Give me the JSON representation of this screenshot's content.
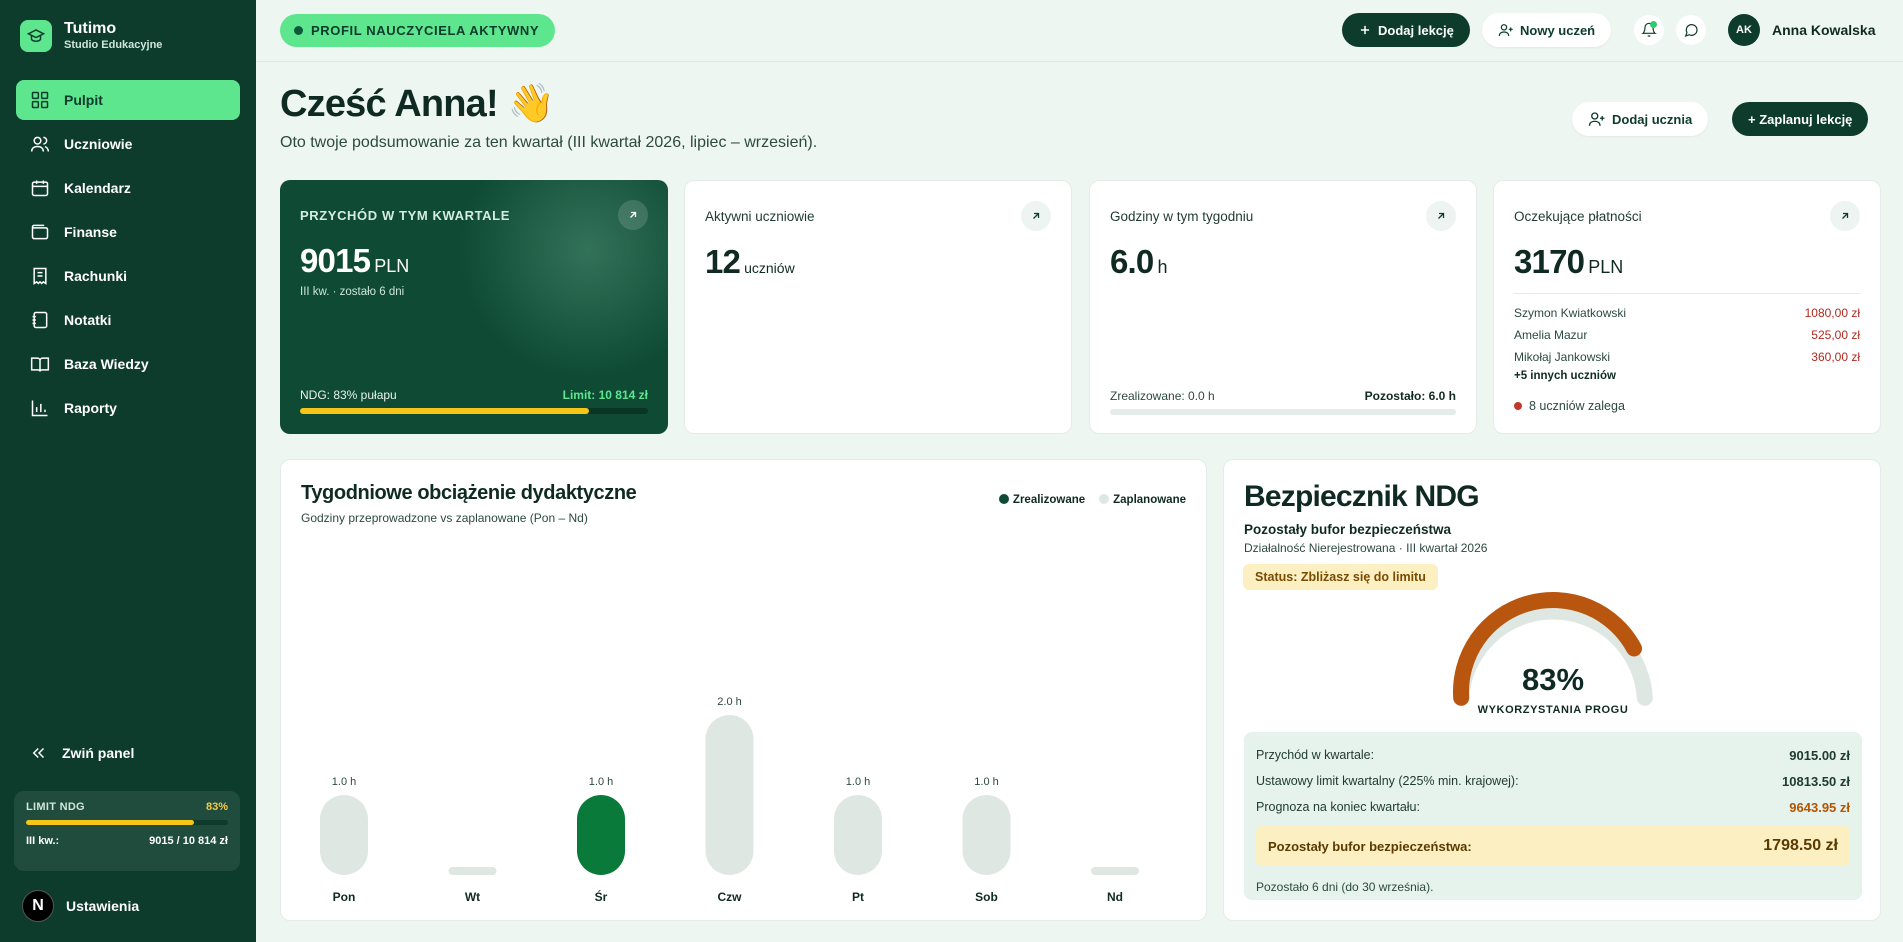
{
  "brand": {
    "name": "Tutimo",
    "subtitle": "Studio Edukacyjne"
  },
  "sidebar": {
    "items": [
      {
        "label": "Pulpit",
        "icon": "grid-icon",
        "active": true
      },
      {
        "label": "Uczniowie",
        "icon": "users-icon"
      },
      {
        "label": "Kalendarz",
        "icon": "calendar-icon"
      },
      {
        "label": "Finanse",
        "icon": "wallet-icon"
      },
      {
        "label": "Rachunki",
        "icon": "receipt-icon"
      },
      {
        "label": "Notatki",
        "icon": "notebook-icon"
      },
      {
        "label": "Baza Wiedzy",
        "icon": "book-icon"
      },
      {
        "label": "Raporty",
        "icon": "bar-chart-icon"
      }
    ],
    "collapse_label": "Zwiń panel",
    "limit": {
      "label": "LIMIT NDG",
      "percent_label": "83%",
      "fill": 0.83,
      "period_label": "III kw.:",
      "value": "9015 / 10 814 zł"
    },
    "settings_label": "Ustawienia",
    "settings_avatar": "N"
  },
  "topbar": {
    "profile_status": "PROFIL NAUCZYCIELA AKTYWNY",
    "add_lesson": "Dodaj lekcję",
    "new_student": "Nowy uczeń",
    "user": {
      "initials": "AK",
      "name": "Anna Kowalska"
    }
  },
  "greeting": {
    "title": "Cześć Anna! 👋",
    "subtitle": "Oto twoje podsumowanie za ten kwartał (III kwartał 2026, lipiec – wrzesień).",
    "add_student": "Dodaj ucznia",
    "schedule_lesson": "+ Zaplanuj lekcję"
  },
  "stats": {
    "revenue": {
      "title": "PRZYCHÓD W TYM KWARTALE",
      "value": "9015",
      "unit": "PLN",
      "note": "III kw. · zostało 6 dni",
      "ndg_label": "NDG: 83% pułapu",
      "limit_label": "Limit: 10 814 zł",
      "fill": 0.83
    },
    "students": {
      "title": "Aktywni uczniowie",
      "value": "12",
      "unit": "uczniów"
    },
    "hours": {
      "title": "Godziny w tym tygodniu",
      "value": "6.0",
      "unit": "h",
      "done_label": "Zrealizowane: 0.0 h",
      "left_label": "Pozostało: 6.0 h",
      "fill": 0.0
    },
    "payments": {
      "title": "Oczekujące płatności",
      "value": "3170",
      "unit": "PLN",
      "rows": [
        {
          "name": "Szymon Kwiatkowski",
          "amount": "1080,00 zł"
        },
        {
          "name": "Amelia Mazur",
          "amount": "525,00 zł"
        },
        {
          "name": "Mikołaj Jankowski",
          "amount": "360,00 zł"
        }
      ],
      "more": "+5 innych uczniów",
      "overdue": "8 uczniów zalega"
    }
  },
  "chart": {
    "title": "Tygodniowe obciążenie dydaktyczne",
    "subtitle": "Godziny przeprowadzone vs zaplanowane (Pon – Nd)",
    "legend_done": "Zrealizowane",
    "legend_planned": "Zaplanowane",
    "colors": {
      "done": "#0e4a34",
      "planned": "#dfe7e3",
      "highlight": "#0a7a3a"
    }
  },
  "chart_data": {
    "type": "bar",
    "categories": [
      "Pon",
      "Wt",
      "Śr",
      "Czw",
      "Pt",
      "Sob",
      "Nd"
    ],
    "values": [
      1.0,
      0,
      1.0,
      2.0,
      1.0,
      1.0,
      0
    ],
    "value_labels": [
      "1.0 h",
      "",
      "1.0 h",
      "2.0 h",
      "1.0 h",
      "1.0 h",
      ""
    ],
    "highlight_index": 2,
    "ylim": [
      0,
      2.0
    ]
  },
  "ndg": {
    "title": "Bezpiecznik NDG",
    "subtitle": "Pozostały bufor bezpieczeństwa",
    "subtitle2": "Działalność Nierejestrowana · III kwartał 2026",
    "status": "Status: Zbliżasz się do limitu",
    "gauge_value": "83%",
    "gauge_label": "WYKORZYSTANIA PROGU",
    "gauge_fill": 0.83,
    "rows": [
      {
        "label": "Przychód w kwartale:",
        "value": "9015.00 zł"
      },
      {
        "label": "Ustawowy limit kwartalny (225% min. krajowej):",
        "value": "10813.50 zł"
      },
      {
        "label": "Prognoza na koniec kwartału:",
        "value": "9643.95 zł"
      }
    ],
    "buffer_label": "Pozostały bufor bezpieczeństwa:",
    "buffer_value": "1798.50 zł",
    "footer": "Pozostało 6 dni (do 30 września)."
  }
}
